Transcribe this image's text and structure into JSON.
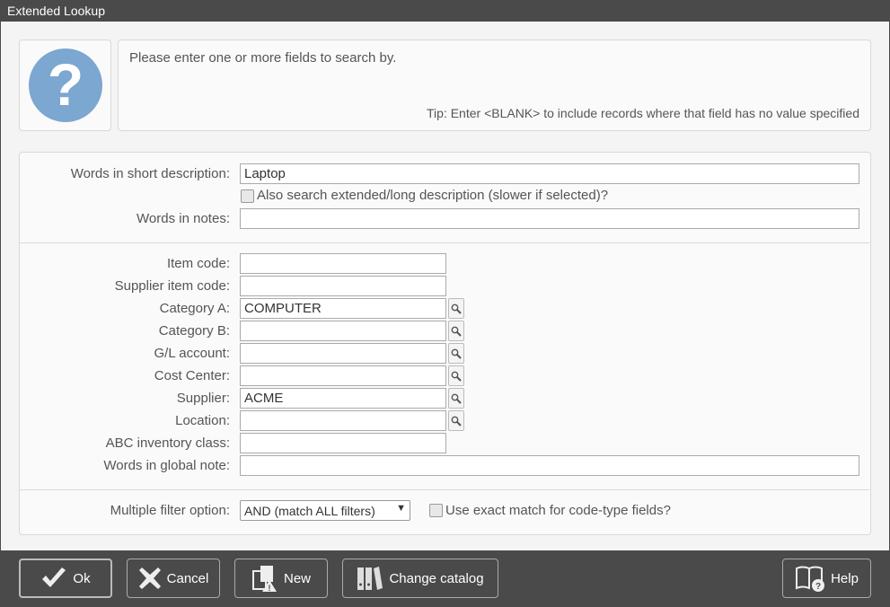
{
  "window": {
    "title": "Extended Lookup"
  },
  "message": {
    "text": "Please enter one or more fields to search by.",
    "tip": "Tip: Enter <BLANK> to include records where that field has no value specified",
    "icon": "question-icon"
  },
  "fields": {
    "short_desc": {
      "label": "Words in short description:",
      "value": "Laptop"
    },
    "extended": {
      "label": "Also search extended/long description (slower if selected)?",
      "checked": false
    },
    "notes": {
      "label": "Words in notes:",
      "value": ""
    },
    "item_code": {
      "label": "Item code:",
      "value": ""
    },
    "supplier_item_code": {
      "label": "Supplier item code:",
      "value": ""
    },
    "category_a": {
      "label": "Category A:",
      "value": "COMPUTER"
    },
    "category_b": {
      "label": "Category B:",
      "value": ""
    },
    "gl_account": {
      "label": "G/L account:",
      "value": ""
    },
    "cost_center": {
      "label": "Cost Center:",
      "value": ""
    },
    "supplier": {
      "label": "Supplier:",
      "value": "ACME"
    },
    "location": {
      "label": "Location:",
      "value": ""
    },
    "abc_class": {
      "label": "ABC inventory class:",
      "value": ""
    },
    "global_note": {
      "label": "Words in global note:",
      "value": ""
    },
    "filter_option": {
      "label": "Multiple filter option:",
      "selected": "AND (match ALL filters)"
    },
    "exact_match": {
      "label": "Use exact match for code-type fields?",
      "checked": false
    }
  },
  "buttons": {
    "ok": "Ok",
    "cancel": "Cancel",
    "new": "New",
    "change_catalog": "Change catalog",
    "help": "Help"
  },
  "colors": {
    "titlebar": "#4a4a4a",
    "icon": "#7ba7d0"
  }
}
